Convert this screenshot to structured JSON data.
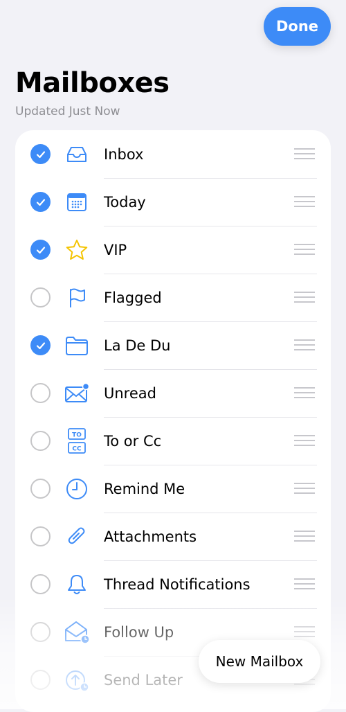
{
  "header": {
    "done_label": "Done",
    "title": "Mailboxes",
    "subtitle": "Updated Just Now"
  },
  "mailboxes": [
    {
      "label": "Inbox",
      "checked": true,
      "icon": "tray-icon"
    },
    {
      "label": "Today",
      "checked": true,
      "icon": "calendar-icon"
    },
    {
      "label": "VIP",
      "checked": true,
      "icon": "star-icon"
    },
    {
      "label": "Flagged",
      "checked": false,
      "icon": "flag-icon"
    },
    {
      "label": "La De Du",
      "checked": true,
      "icon": "folder-icon"
    },
    {
      "label": "Unread",
      "checked": false,
      "icon": "unread-envelope-icon"
    },
    {
      "label": "To or Cc",
      "checked": false,
      "icon": "to-cc-icon"
    },
    {
      "label": "Remind Me",
      "checked": false,
      "icon": "clock-icon"
    },
    {
      "label": "Attachments",
      "checked": false,
      "icon": "paperclip-icon"
    },
    {
      "label": "Thread Notifications",
      "checked": false,
      "icon": "bell-icon"
    },
    {
      "label": "Follow Up",
      "checked": false,
      "icon": "follow-up-envelope-icon"
    },
    {
      "label": "Send Later",
      "checked": false,
      "icon": "send-later-icon"
    }
  ],
  "footer": {
    "new_mailbox_label": "New Mailbox"
  },
  "colors": {
    "accent": "#3d8bf7",
    "star": "#f4c400",
    "background": "#f2f2f7"
  }
}
